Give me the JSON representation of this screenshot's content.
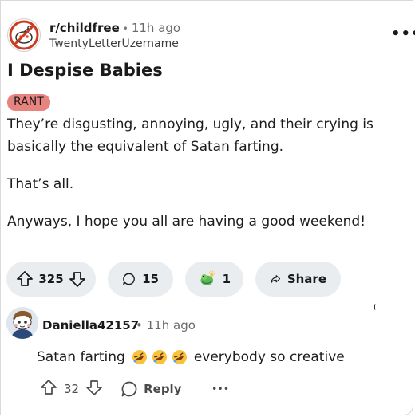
{
  "post": {
    "subreddit": "r/childfree",
    "separator": "•",
    "time": "11h ago",
    "author": "TwentyLetterUzername",
    "more_label": "•••",
    "title": "I Despise Babies",
    "flair": "RANT",
    "paragraphs": [
      "They’re disgusting, annoying, ugly, and their crying is basically the equivalent of Satan farting.",
      "That’s all.",
      "Anyways, I hope you all are having a good weekend!"
    ]
  },
  "actions": {
    "votes": "325",
    "comments": "15",
    "awards": "1",
    "share_label": "Share"
  },
  "comment": {
    "username": "Daniella42157",
    "separator": "•",
    "time": "11h ago",
    "text_prefix": "Satan farting",
    "text_suffix": "everybody so creative",
    "emoji_name": "rolling-on-floor-laughing",
    "votes": "32",
    "reply_label": "Reply",
    "more_label": "•••"
  },
  "colors": {
    "flair_bg": "#e7847f",
    "pill_bg": "#eaedef",
    "text": "#1a1a1b"
  }
}
